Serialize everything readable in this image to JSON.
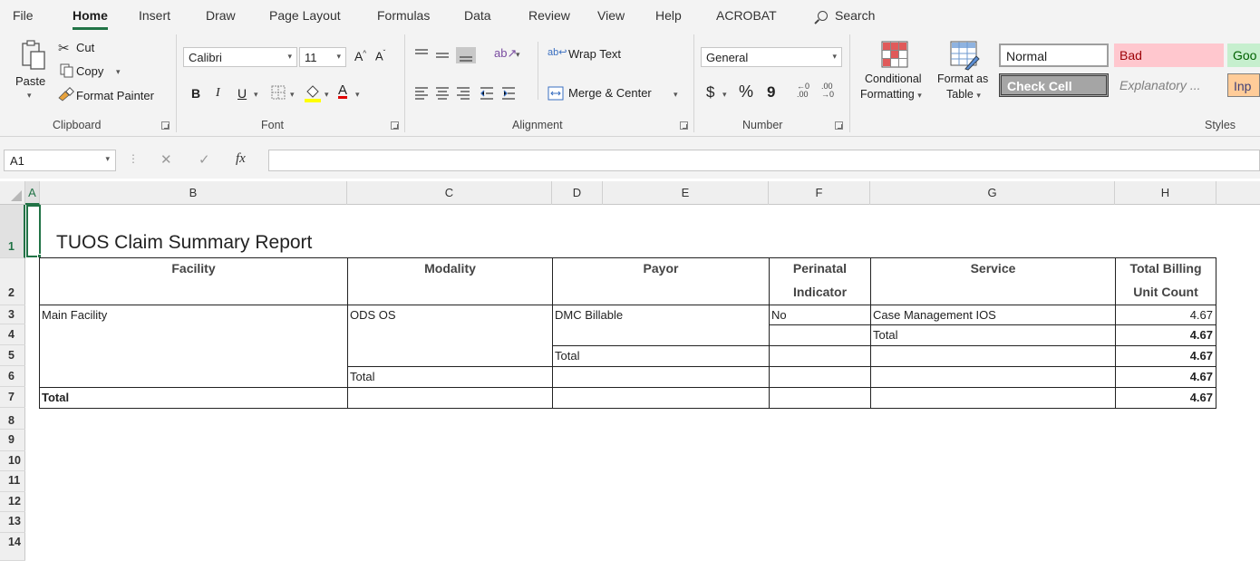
{
  "ribbon_tabs": [
    "File",
    "Home",
    "Insert",
    "Draw",
    "Page Layout",
    "Formulas",
    "Data",
    "Review",
    "View",
    "Help",
    "ACROBAT"
  ],
  "search_label": "Search",
  "clipboard": {
    "paste": "Paste",
    "cut": "Cut",
    "copy": "Copy",
    "format_painter": "Format Painter",
    "label": "Clipboard"
  },
  "font": {
    "name": "Calibri",
    "size": "11",
    "label": "Font",
    "bold": "B",
    "italic": "I",
    "underline": "U",
    "grow": "A",
    "shrink": "A"
  },
  "alignment": {
    "wrap_text": "Wrap Text",
    "merge_center": "Merge & Center",
    "label": "Alignment"
  },
  "number": {
    "format": "General",
    "currency": "$",
    "percent": "%",
    "comma": "9",
    "label": "Number"
  },
  "styles_group": {
    "conditional": [
      "Conditional",
      "Formatting"
    ],
    "format_table": [
      "Format as",
      "Table"
    ],
    "cell_styles": [
      "Normal",
      "Bad",
      "Goo",
      "Check Cell",
      "Explanatory ...",
      "Inp"
    ],
    "label": "Styles"
  },
  "colors": {
    "excel_green": "#217346",
    "bad_fill": "#ffc7ce",
    "bad_text": "#9c0006",
    "good_fill": "#c6efce",
    "good_text": "#006100",
    "input_fill": "#ffcc99",
    "input_text": "#3f3f76",
    "check_fill": "#a5a5a5"
  },
  "namebox": "A1",
  "formula_symbol": "fx",
  "columns": [
    "A",
    "B",
    "C",
    "D",
    "E",
    "F",
    "G",
    "H"
  ],
  "rows": [
    "1",
    "2",
    "3",
    "4",
    "5",
    "6",
    "7",
    "8",
    "9",
    "10",
    "11",
    "12",
    "13",
    "14"
  ],
  "report": {
    "title": "TUOS Claim Summary Report",
    "headers": {
      "facility": "Facility",
      "modality": "Modality",
      "payor": "Payor",
      "perinatal": [
        "Perinatal",
        "Indicator"
      ],
      "service": "Service",
      "billing": [
        "Total Billing",
        "Unit Count"
      ]
    },
    "rows": [
      {
        "facility": "Main Facility",
        "modality": "ODS OS",
        "payor": "DMC Billable",
        "perinatal": "No",
        "service": "Case Management IOS",
        "billing": "4.67"
      },
      {
        "service": "Total",
        "billing": "4.67"
      },
      {
        "payor": "Total",
        "billing": "4.67"
      },
      {
        "modality": "Total",
        "billing": "4.67"
      },
      {
        "facility": "Total",
        "billing": "4.67"
      }
    ]
  }
}
